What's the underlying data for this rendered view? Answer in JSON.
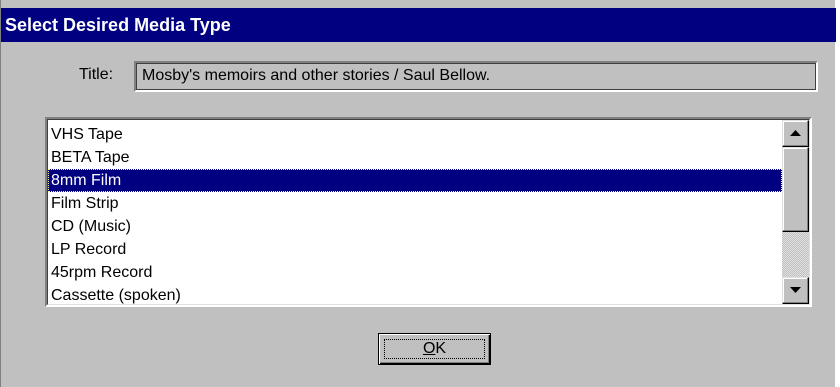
{
  "window": {
    "title": "Select Desired Media Type"
  },
  "title_field": {
    "label": "Title:",
    "value": "Mosby's memoirs and other stories / Saul Bellow."
  },
  "media_list": {
    "items": [
      "VHS Tape",
      "BETA Tape",
      "8mm Film",
      "Film Strip",
      "CD (Music)",
      "LP Record",
      "45rpm Record",
      "Cassette (spoken)"
    ],
    "selected": "8mm Film"
  },
  "buttons": {
    "ok_mnemonic": "O",
    "ok_rest": "K"
  },
  "icons": {
    "scroll_up": "scroll-up-arrow-icon",
    "scroll_down": "scroll-down-arrow-icon"
  },
  "colors": {
    "titlebar": "#000080",
    "selection": "#000080",
    "face": "#c0c0c0"
  }
}
